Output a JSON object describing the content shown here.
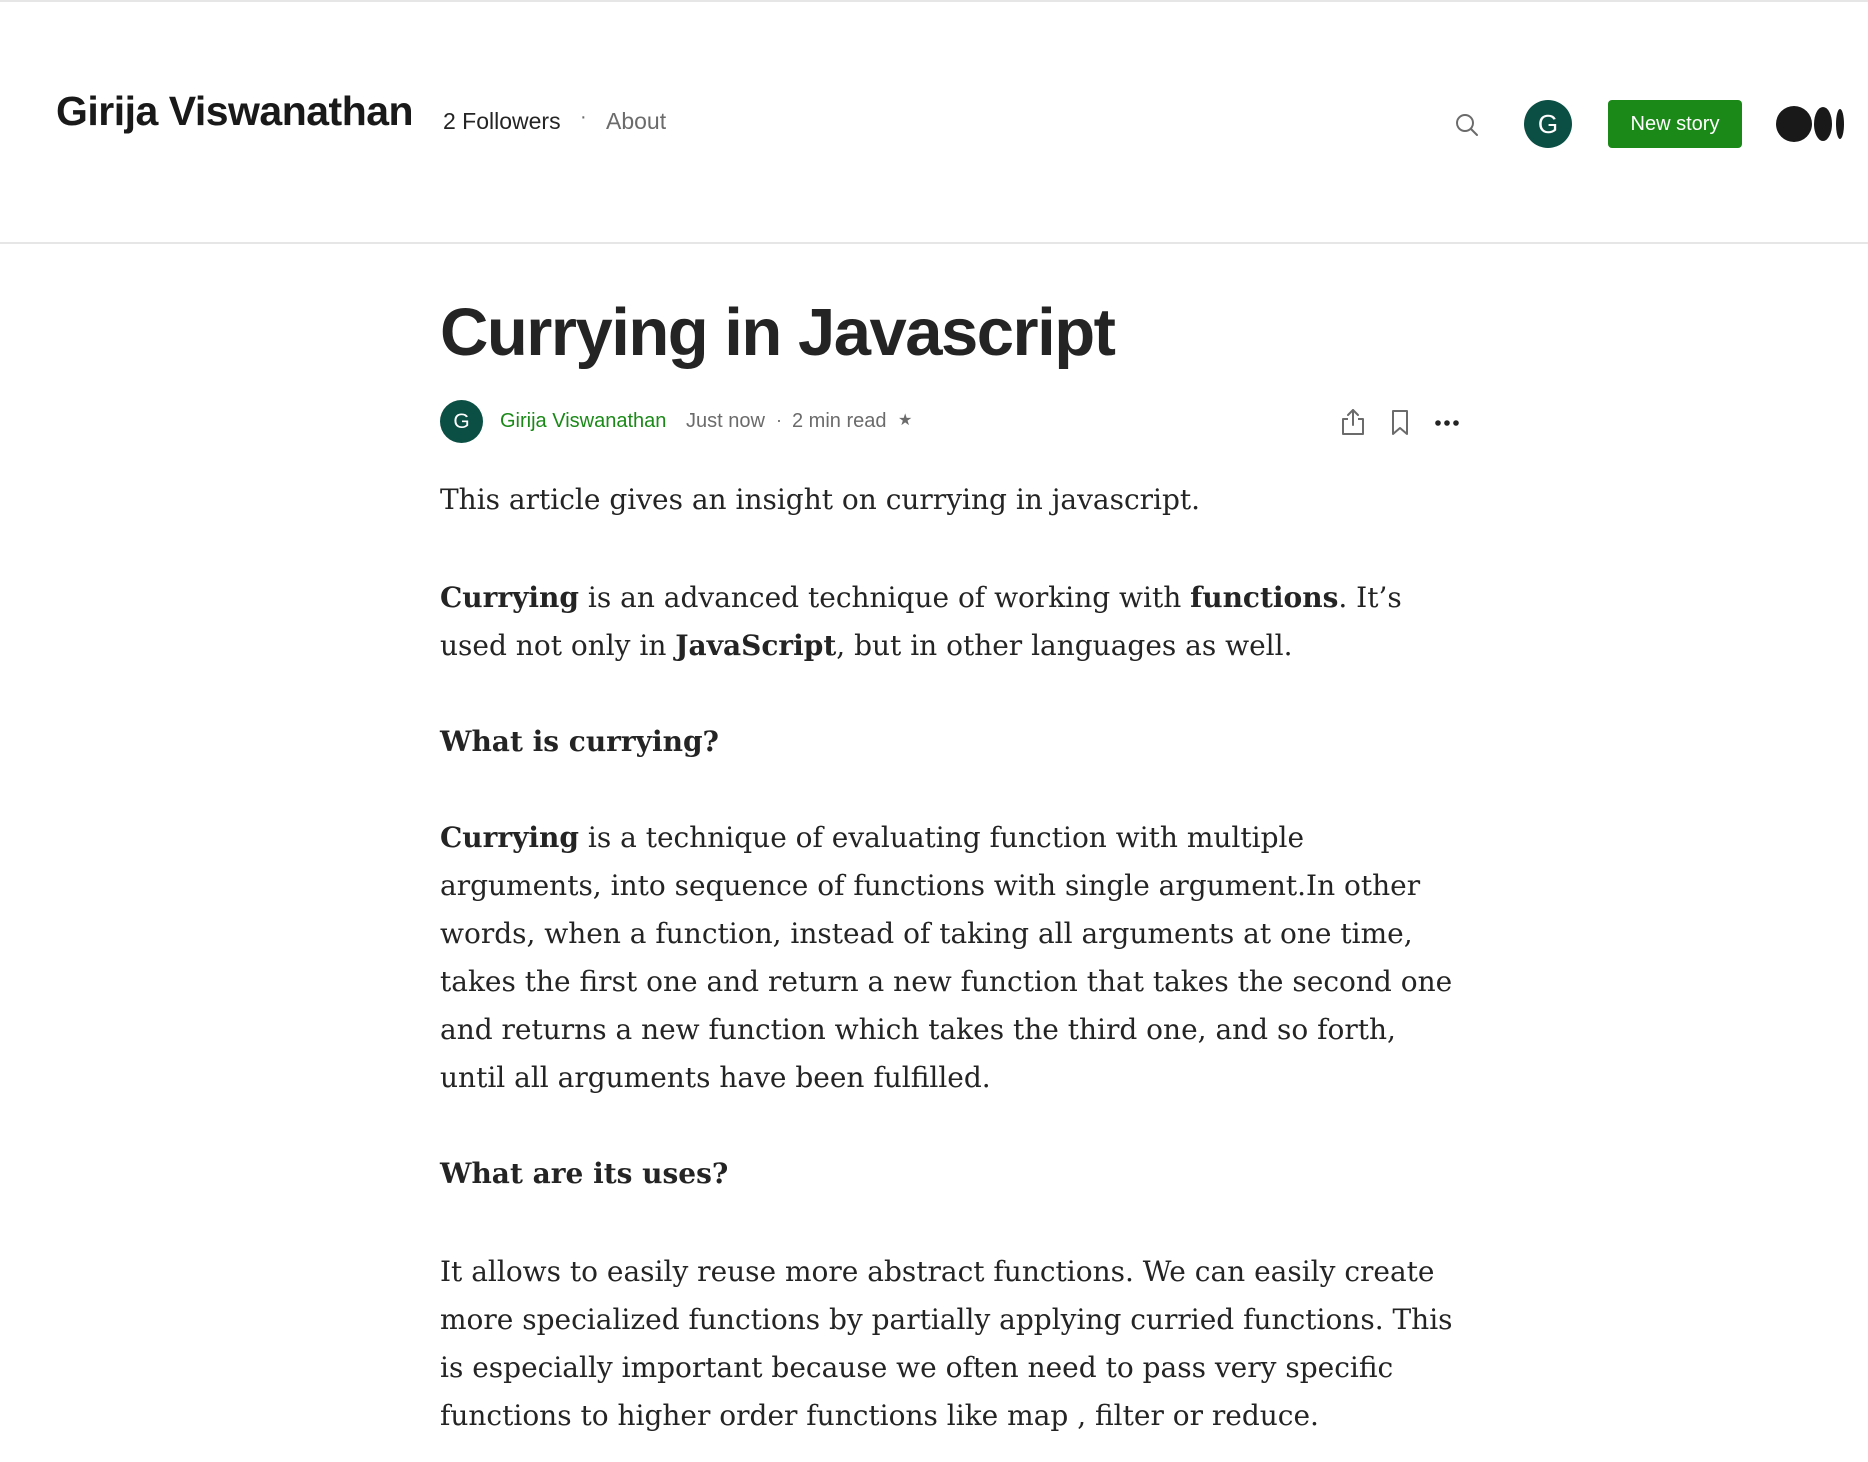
{
  "header": {
    "publication_name": "Girija Viswanathan",
    "followers": "2 Followers",
    "separator": "·",
    "about": "About",
    "search_icon": "search-icon",
    "avatar_initial": "G",
    "new_story": "New story",
    "logo_icon": "medium-logo-icon"
  },
  "article": {
    "title": "Currying in Javascript",
    "author": {
      "initial": "G",
      "name": "Girija Viswanathan"
    },
    "published": "Just now",
    "meta_separator": "·",
    "read_time": "2 min read",
    "star": "★",
    "actions": [
      "share-icon",
      "bookmark-icon",
      "more-icon"
    ],
    "intro": "This article gives an insight on currying in javascript.",
    "p1": {
      "b1": "Currying",
      "t1": " is an advanced technique of working with ",
      "b2": "functions",
      "t2": ". It’s used not only in ",
      "b3": "JavaScript",
      "t3": ", but in other languages as well."
    },
    "heading_what": "What is currying?",
    "p2": {
      "b1": "Currying",
      "t1": " is a technique of evaluating function with multiple arguments, into sequence of functions with single argument.In other words, when a function, instead of taking all arguments at one time, takes the first one and return a new function that takes the second one and returns a new function which takes the third one, and so forth, until all arguments have been fulfilled."
    },
    "heading_uses": "What are its uses?",
    "p3": "It allows to easily reuse more abstract functions. We can easily create more specialized functions by partially applying curried functions. This is especially important because we often need to pass very specific functions to higher order functions like map , filter or reduce."
  },
  "colors": {
    "accent_green": "#1a8917",
    "avatar_bg": "#0b4f44",
    "text": "#242424",
    "muted": "#6b6b6b"
  }
}
